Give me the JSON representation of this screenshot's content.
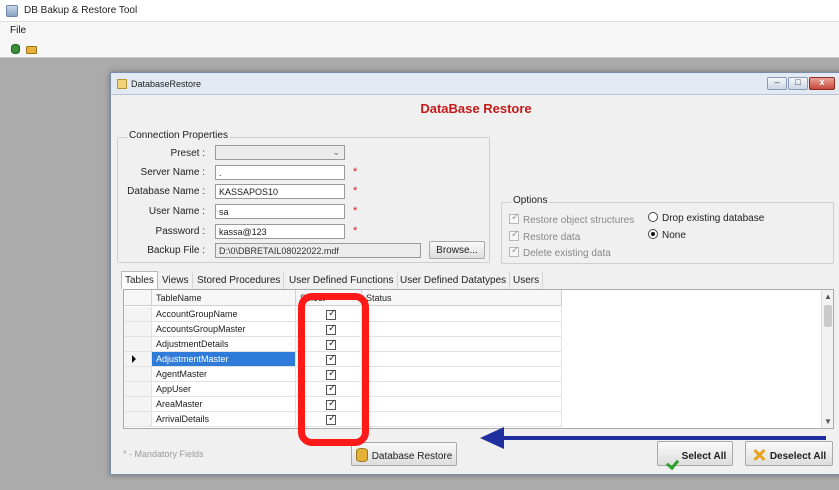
{
  "app": {
    "title": "DB Bakup & Restore Tool",
    "menu": [
      "File"
    ],
    "toolbar": [
      {
        "icon": "database-icon"
      },
      {
        "icon": "folder-icon"
      }
    ]
  },
  "dialog": {
    "title": "DatabaseRestore",
    "heading": "DataBase Restore",
    "window_buttons": {
      "minimize": "–",
      "maximize": "□",
      "close": "x"
    }
  },
  "connection": {
    "group_label": "Connection Properties",
    "preset": {
      "label": "Preset :",
      "value": ""
    },
    "server_name": {
      "label": "Server Name :",
      "value": "."
    },
    "database_name": {
      "label": "Database Name :",
      "value": "KASSAPOS10"
    },
    "user_name": {
      "label": "User Name :",
      "value": "sa"
    },
    "password": {
      "label": "Password :",
      "value": "kassa@123"
    },
    "backup_file": {
      "label": "Backup File :",
      "value": "D:\\0\\DBRETAIL08022022.mdf"
    },
    "browse_label": "Browse...",
    "required_mark": "*"
  },
  "options": {
    "group_label": "Options",
    "restore_object_structures": "Restore object structures",
    "restore_data": "Restore data",
    "delete_existing_data": "Delete existing data",
    "drop_existing_database": "Drop existing database",
    "none": "None"
  },
  "tabs": [
    "Tables",
    "Views",
    "Stored Procedures",
    "User Defined Functions",
    "User Defined Datatypes",
    "Users"
  ],
  "grid": {
    "columns": [
      "TableName",
      "Select",
      "Status"
    ],
    "rows": [
      {
        "name": "AccountGroupName",
        "selected": true,
        "status": ""
      },
      {
        "name": "AccountsGroupMaster",
        "selected": true,
        "status": ""
      },
      {
        "name": "AdjustmentDetails",
        "selected": true,
        "status": ""
      },
      {
        "name": "AdjustmentMaster",
        "selected": true,
        "status": ""
      },
      {
        "name": "AgentMaster",
        "selected": true,
        "status": ""
      },
      {
        "name": "AppUser",
        "selected": true,
        "status": ""
      },
      {
        "name": "AreaMaster",
        "selected": true,
        "status": ""
      },
      {
        "name": "ArrivalDetails",
        "selected": true,
        "status": ""
      }
    ],
    "current_row": 3
  },
  "footer": {
    "mandatory_note": "* - Mandatory Fields",
    "database_restore": "Database Restore",
    "select_all": "Select All",
    "deselect_all": "Deselect All"
  },
  "colors": {
    "heading": "#c61a1a",
    "selection": "#2f7bd9",
    "annotation_rect": "#ff1a1a",
    "annotation_arrow": "#1f2f9e"
  }
}
